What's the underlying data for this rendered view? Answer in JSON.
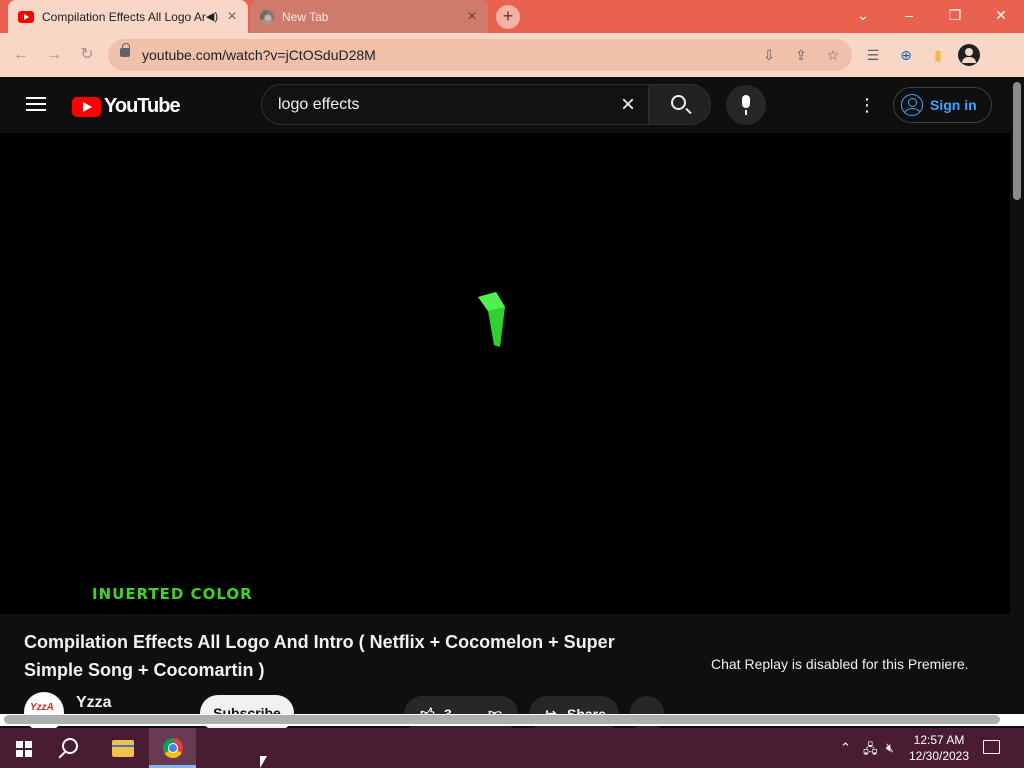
{
  "browser": {
    "tabs": [
      {
        "title": "Compilation Effects All Logo And Intro",
        "active": true
      },
      {
        "title": "New Tab",
        "active": false
      }
    ],
    "url": "youtube.com/watch?v=jCtOSduD28M"
  },
  "youtube": {
    "logo_text": "YouTube",
    "search_query": "logo effects",
    "signin_label": "Sign in",
    "video_overlay_text": "INUERTED COLOR",
    "video_title": "Compilation Effects All Logo And Intro ( Netflix + Cocomelon + Super Simple Song + Cocomartin )",
    "chat_message": "Chat Replay is disabled for this Premiere.",
    "channel_name": "Yzza",
    "avatar_text": "YzzA",
    "subscribe_label": "Subscribe",
    "like_count": "3",
    "share_label": "Share"
  },
  "taskbar": {
    "time": "12:57 AM",
    "date": "12/30/2023"
  },
  "colors": {
    "tab_strip": "#e8624f",
    "toolbar": "#f8d7c7",
    "youtube_red": "#ff0000",
    "overlay_green": "#41d323",
    "taskbar": "#4a1c31"
  }
}
